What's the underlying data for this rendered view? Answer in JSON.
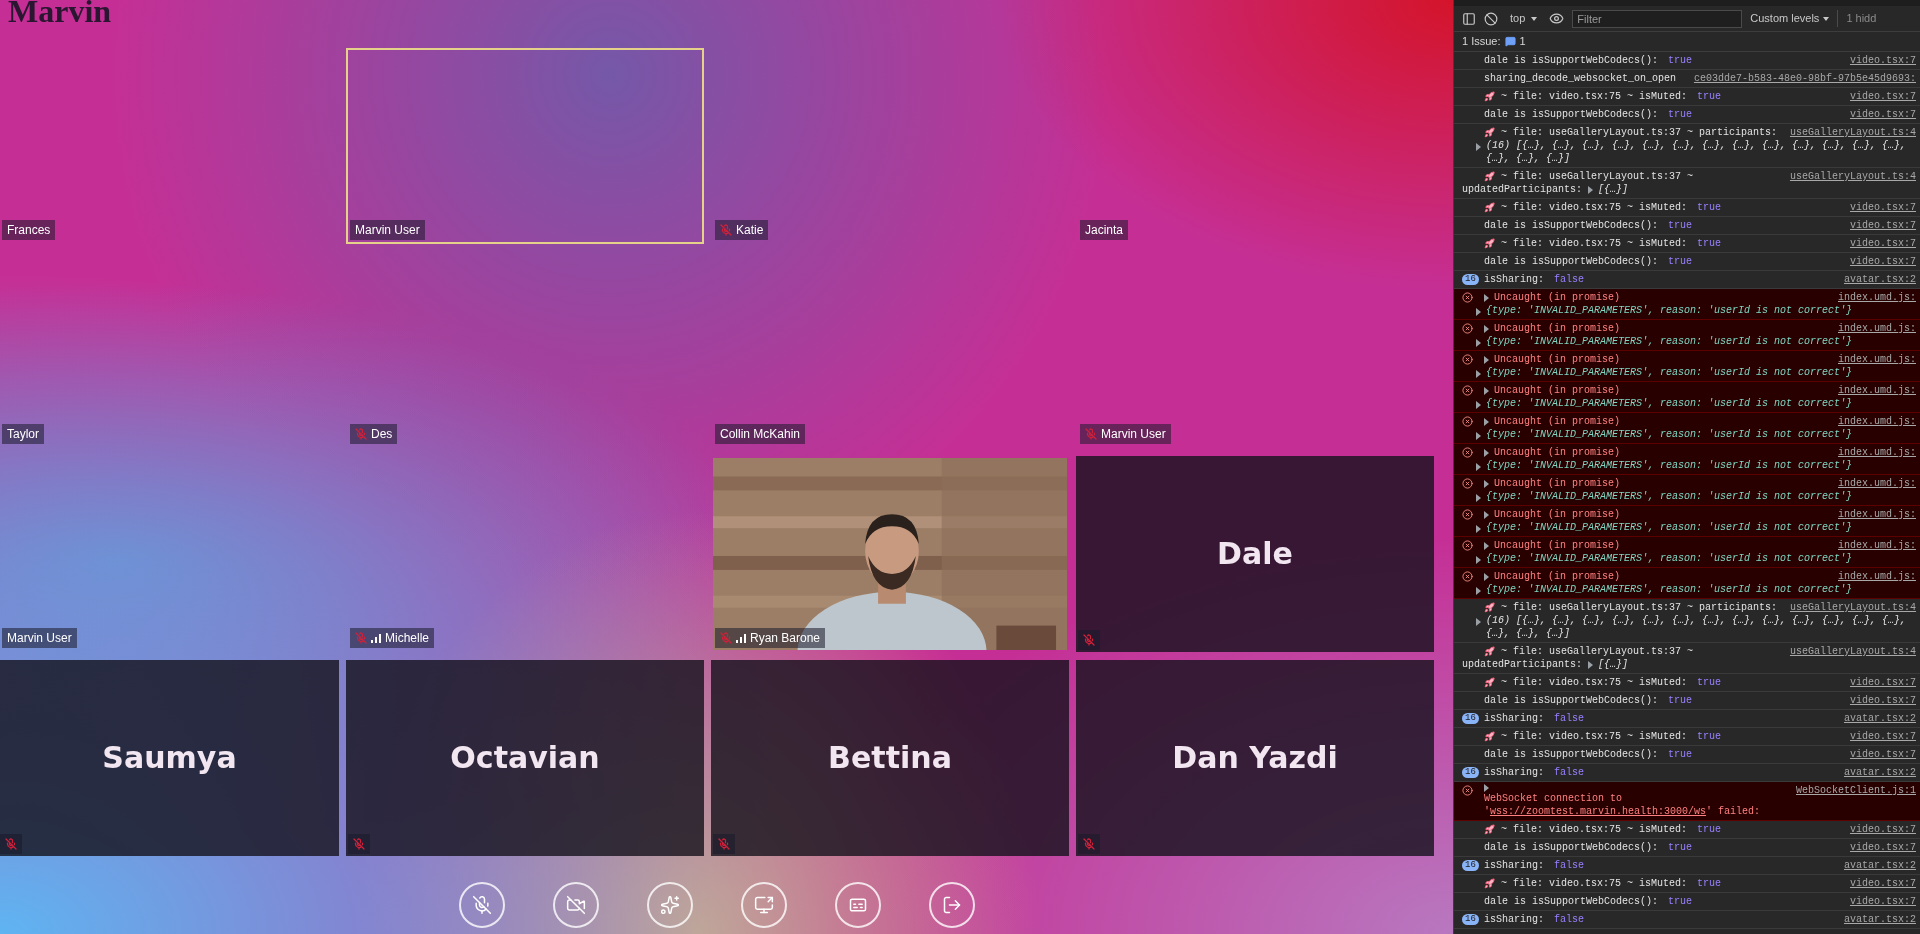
{
  "app": {
    "title": "Marvin"
  },
  "tiles": [
    {
      "kind": "empty",
      "name": "Frances",
      "muted": false,
      "signal": false,
      "speaking": false
    },
    {
      "kind": "empty",
      "name": "Marvin User",
      "muted": false,
      "signal": false,
      "speaking": true
    },
    {
      "kind": "empty",
      "name": "Katie",
      "muted": true,
      "signal": false,
      "speaking": false
    },
    {
      "kind": "empty",
      "name": "Jacinta",
      "muted": false,
      "signal": false,
      "speaking": false
    },
    {
      "kind": "empty",
      "name": "Taylor",
      "muted": false,
      "signal": false,
      "speaking": false
    },
    {
      "kind": "empty",
      "name": "Des",
      "muted": true,
      "signal": false,
      "speaking": false
    },
    {
      "kind": "empty",
      "name": "Collin McKahin",
      "muted": false,
      "signal": false,
      "speaking": false
    },
    {
      "kind": "empty",
      "name": "Marvin User",
      "muted": true,
      "signal": false,
      "speaking": false
    },
    {
      "kind": "empty",
      "name": "Marvin User",
      "muted": false,
      "signal": false,
      "speaking": false
    },
    {
      "kind": "empty",
      "name": "Michelle",
      "muted": true,
      "signal": true,
      "speaking": false
    },
    {
      "kind": "video",
      "name": "Ryan Barone",
      "muted": true,
      "signal": true,
      "speaking": false
    },
    {
      "kind": "avatar",
      "name": "Dale",
      "muted": true,
      "signal": false,
      "speaking": false
    },
    {
      "kind": "avatar",
      "name": "Saumya",
      "muted": true,
      "signal": false,
      "speaking": false
    },
    {
      "kind": "avatar",
      "name": "Octavian",
      "muted": true,
      "signal": false,
      "speaking": false
    },
    {
      "kind": "avatar",
      "name": "Bettina",
      "muted": true,
      "signal": false,
      "speaking": false
    },
    {
      "kind": "avatar",
      "name": "Dan Yazdi",
      "muted": true,
      "signal": false,
      "speaking": false
    }
  ],
  "controls": [
    {
      "kind": "mic-off"
    },
    {
      "kind": "camera-off"
    },
    {
      "kind": "effects"
    },
    {
      "kind": "share-screen"
    },
    {
      "kind": "captions"
    },
    {
      "kind": "leave"
    }
  ],
  "devtools": {
    "toolbar": {
      "context": "top",
      "filter_placeholder": "Filter",
      "levels": "Custom levels",
      "hidden": "1 hidd"
    },
    "issues": {
      "label": "1 Issue:",
      "count": "1"
    },
    "messages": [
      {
        "kind": "log",
        "text": "dale is isSupportWebCodecs():",
        "value": {
          "kind": "boolean",
          "text": "true"
        },
        "source": "video.tsx:7"
      },
      {
        "kind": "log",
        "text": "sharing_decode_websocket_on_open",
        "source": "ce03dde7-b583-48e0-98bf-97b5e45d9693:"
      },
      {
        "kind": "trace",
        "text": "~ file: video.tsx:75 ~ isMuted:",
        "value": {
          "kind": "boolean",
          "text": "true"
        },
        "source": "video.tsx:7"
      },
      {
        "kind": "log",
        "text": "dale is isSupportWebCodecs():",
        "value": {
          "kind": "boolean",
          "text": "true"
        },
        "source": "video.tsx:7"
      },
      {
        "kind": "trace",
        "text": "~ file: useGalleryLayout.ts:37 ~ participants:",
        "source": "useGalleryLayout.ts:4",
        "detail": "(16) [{…}, {…}, {…}, {…}, {…}, {…}, {…}, {…}, {…}, {…}, {…}, {…}, {…}, {…}, {…}, {…}]"
      },
      {
        "kind": "trace",
        "text": "~ file: useGalleryLayout.ts:37 ~",
        "text2": "updatedParticipants:",
        "value": {
          "kind": "object",
          "text": "[{…}]"
        },
        "source": "useGalleryLayout.ts:4"
      },
      {
        "kind": "trace",
        "text": "~ file: video.tsx:75 ~ isMuted:",
        "value": {
          "kind": "boolean",
          "text": "true"
        },
        "source": "video.tsx:7"
      },
      {
        "kind": "log",
        "text": "dale is isSupportWebCodecs():",
        "value": {
          "kind": "boolean",
          "text": "true"
        },
        "source": "video.tsx:7"
      },
      {
        "kind": "trace",
        "text": "~ file: video.tsx:75 ~ isMuted:",
        "value": {
          "kind": "boolean",
          "text": "true"
        },
        "source": "video.tsx:7"
      },
      {
        "kind": "log",
        "text": "dale is isSupportWebCodecs():",
        "value": {
          "kind": "boolean",
          "text": "true"
        },
        "source": "video.tsx:7"
      },
      {
        "kind": "log",
        "badge": "16",
        "text": "isSharing:",
        "value": {
          "kind": "boolean",
          "text": "false"
        },
        "source": "avatar.tsx:2"
      },
      {
        "kind": "error",
        "text": "Uncaught (in promise)",
        "source": "index.umd.js:",
        "detail": "{type: 'INVALID_PARAMETERS', reason: 'userId is not correct'}"
      },
      {
        "kind": "error",
        "text": "Uncaught (in promise)",
        "source": "index.umd.js:",
        "detail": "{type: 'INVALID_PARAMETERS', reason: 'userId is not correct'}"
      },
      {
        "kind": "error",
        "text": "Uncaught (in promise)",
        "source": "index.umd.js:",
        "detail": "{type: 'INVALID_PARAMETERS', reason: 'userId is not correct'}"
      },
      {
        "kind": "error",
        "text": "Uncaught (in promise)",
        "source": "index.umd.js:",
        "detail": "{type: 'INVALID_PARAMETERS', reason: 'userId is not correct'}"
      },
      {
        "kind": "error",
        "text": "Uncaught (in promise)",
        "source": "index.umd.js:",
        "detail": "{type: 'INVALID_PARAMETERS', reason: 'userId is not correct'}"
      },
      {
        "kind": "error",
        "text": "Uncaught (in promise)",
        "source": "index.umd.js:",
        "detail": "{type: 'INVALID_PARAMETERS', reason: 'userId is not correct'}"
      },
      {
        "kind": "error",
        "text": "Uncaught (in promise)",
        "source": "index.umd.js:",
        "detail": "{type: 'INVALID_PARAMETERS', reason: 'userId is not correct'}"
      },
      {
        "kind": "error",
        "text": "Uncaught (in promise)",
        "source": "index.umd.js:",
        "detail": "{type: 'INVALID_PARAMETERS', reason: 'userId is not correct'}"
      },
      {
        "kind": "error",
        "text": "Uncaught (in promise)",
        "source": "index.umd.js:",
        "detail": "{type: 'INVALID_PARAMETERS', reason: 'userId is not correct'}"
      },
      {
        "kind": "error",
        "text": "Uncaught (in promise)",
        "source": "index.umd.js:",
        "detail": "{type: 'INVALID_PARAMETERS', reason: 'userId is not correct'}"
      },
      {
        "kind": "trace",
        "text": "~ file: useGalleryLayout.ts:37 ~ participants:",
        "source": "useGalleryLayout.ts:4",
        "detail": "(16) [{…}, {…}, {…}, {…}, {…}, {…}, {…}, {…}, {…}, {…}, {…}, {…}, {…}, {…}, {…}, {…}]"
      },
      {
        "kind": "trace",
        "text": "~ file: useGalleryLayout.ts:37 ~",
        "text2": "updatedParticipants:",
        "value": {
          "kind": "object",
          "text": "[{…}]"
        },
        "source": "useGalleryLayout.ts:4"
      },
      {
        "kind": "trace",
        "text": "~ file: video.tsx:75 ~ isMuted:",
        "value": {
          "kind": "boolean",
          "text": "true"
        },
        "source": "video.tsx:7"
      },
      {
        "kind": "log",
        "text": "dale is isSupportWebCodecs():",
        "value": {
          "kind": "boolean",
          "text": "true"
        },
        "source": "video.tsx:7"
      },
      {
        "kind": "log",
        "badge": "16",
        "text": "isSharing:",
        "value": {
          "kind": "boolean",
          "text": "false"
        },
        "source": "avatar.tsx:2"
      },
      {
        "kind": "trace",
        "text": "~ file: video.tsx:75 ~ isMuted:",
        "value": {
          "kind": "boolean",
          "text": "true"
        },
        "source": "video.tsx:7"
      },
      {
        "kind": "log",
        "text": "dale is isSupportWebCodecs():",
        "value": {
          "kind": "boolean",
          "text": "true"
        },
        "source": "video.tsx:7"
      },
      {
        "kind": "log",
        "badge": "16",
        "text": "isSharing:",
        "value": {
          "kind": "boolean",
          "text": "false"
        },
        "source": "avatar.tsx:2"
      },
      {
        "kind": "error",
        "parts": [
          {
            "kind": "plain",
            "text": "WebSocket connection to '"
          },
          {
            "kind": "link",
            "text": "wss://zoomtest.marvin.health:3000/ws"
          },
          {
            "kind": "plain",
            "text": "' failed:"
          }
        ],
        "source": "WebSocketClient.js:1"
      },
      {
        "kind": "trace",
        "text": "~ file: video.tsx:75 ~ isMuted:",
        "value": {
          "kind": "boolean",
          "text": "true"
        },
        "source": "video.tsx:7"
      },
      {
        "kind": "log",
        "text": "dale is isSupportWebCodecs():",
        "value": {
          "kind": "boolean",
          "text": "true"
        },
        "source": "video.tsx:7"
      },
      {
        "kind": "log",
        "badge": "16",
        "text": "isSharing:",
        "value": {
          "kind": "boolean",
          "text": "false"
        },
        "source": "avatar.tsx:2"
      },
      {
        "kind": "trace",
        "text": "~ file: video.tsx:75 ~ isMuted:",
        "value": {
          "kind": "boolean",
          "text": "true"
        },
        "source": "video.tsx:7"
      },
      {
        "kind": "log",
        "text": "dale is isSupportWebCodecs():",
        "value": {
          "kind": "boolean",
          "text": "true"
        },
        "source": "video.tsx:7"
      },
      {
        "kind": "log",
        "badge": "16",
        "text": "isSharing:",
        "value": {
          "kind": "boolean",
          "text": "false"
        },
        "source": "avatar.tsx:2"
      }
    ]
  }
}
